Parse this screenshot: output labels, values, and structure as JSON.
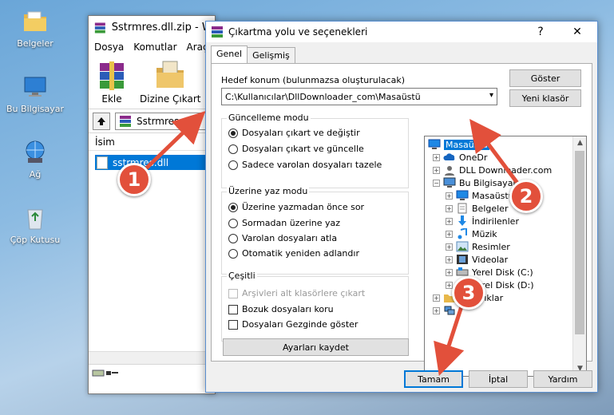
{
  "desktop": {
    "icons": [
      {
        "label": "Belgeler",
        "icon": "folder-icon"
      },
      {
        "label": "Bu Bilgisayar",
        "icon": "computer-icon"
      },
      {
        "label": "Ağ",
        "icon": "network-icon"
      },
      {
        "label": "Çöp Kutusu",
        "icon": "recycle-bin-icon"
      }
    ]
  },
  "winrar": {
    "title": "Sstrmres.dll.zip - Wi",
    "menu": [
      "Dosya",
      "Komutlar",
      "Araçla"
    ],
    "toolbar": {
      "add_label": "Ekle",
      "extract_label": "Dizine Çıkart"
    },
    "path": "Sstrmres.dl",
    "column_name": "İsim",
    "file": "sstrmres.dll"
  },
  "dialog": {
    "title": "Çıkartma yolu ve seçenekleri",
    "help": "?",
    "close": "✕",
    "tabs": [
      "Genel",
      "Gelişmiş"
    ],
    "dest_label": "Hedef konum (bulunmazsa oluşturulacak)",
    "dest_value": "C:\\Kullanıcılar\\DllDownloader_com\\Masaüstü",
    "show_button": "Göster",
    "new_folder_button": "Yeni klasör",
    "update_group": {
      "label": "Güncelleme modu",
      "options": [
        "Dosyaları çıkart ve değiştir",
        "Dosyaları çıkart ve güncelle",
        "Sadece varolan dosyaları tazele"
      ],
      "selected": 0
    },
    "overwrite_group": {
      "label": "Üzerine yaz modu",
      "options": [
        "Üzerine yazmadan önce sor",
        "Sormadan üzerine yaz",
        "Varolan dosyaları atla",
        "Otomatik yeniden adlandır"
      ],
      "selected": 0
    },
    "misc_group": {
      "label": "Çeşitli",
      "options": [
        "Arşivleri alt klasörlere çıkart",
        "Bozuk dosyaları koru",
        "Dosyaları Gezginde göster"
      ]
    },
    "save_settings": "Ayarları kaydet",
    "tree": [
      {
        "label": "Masaüstü",
        "icon": "desktop-icon"
      },
      {
        "label": "OneDr",
        "icon": "onedrive-icon"
      },
      {
        "label": "DLL Downloader.com",
        "icon": "user-icon"
      },
      {
        "label": "Bu Bilgisayar",
        "icon": "computer-icon"
      },
      {
        "label": "Masaüstü",
        "icon": "desktop-icon"
      },
      {
        "label": "Belgeler",
        "icon": "documents-icon"
      },
      {
        "label": "İndirilenler",
        "icon": "download-icon"
      },
      {
        "label": "Müzik",
        "icon": "music-icon"
      },
      {
        "label": "Resimler",
        "icon": "pictures-icon"
      },
      {
        "label": "Videolar",
        "icon": "videos-icon"
      },
      {
        "label": "Yerel Disk (C:)",
        "icon": "disk-icon"
      },
      {
        "label": "Yerel Disk (D:)",
        "icon": "disk-icon"
      },
      {
        "label": "Kitaplıklar",
        "icon": "libraries-icon"
      },
      {
        "label": "",
        "icon": "network-icon"
      }
    ],
    "ok": "Tamam",
    "cancel": "İptal",
    "help_button": "Yardım"
  },
  "markers": [
    "1",
    "2",
    "3"
  ],
  "colors": {
    "selection": "#0078d7",
    "marker": "#e2503b"
  }
}
